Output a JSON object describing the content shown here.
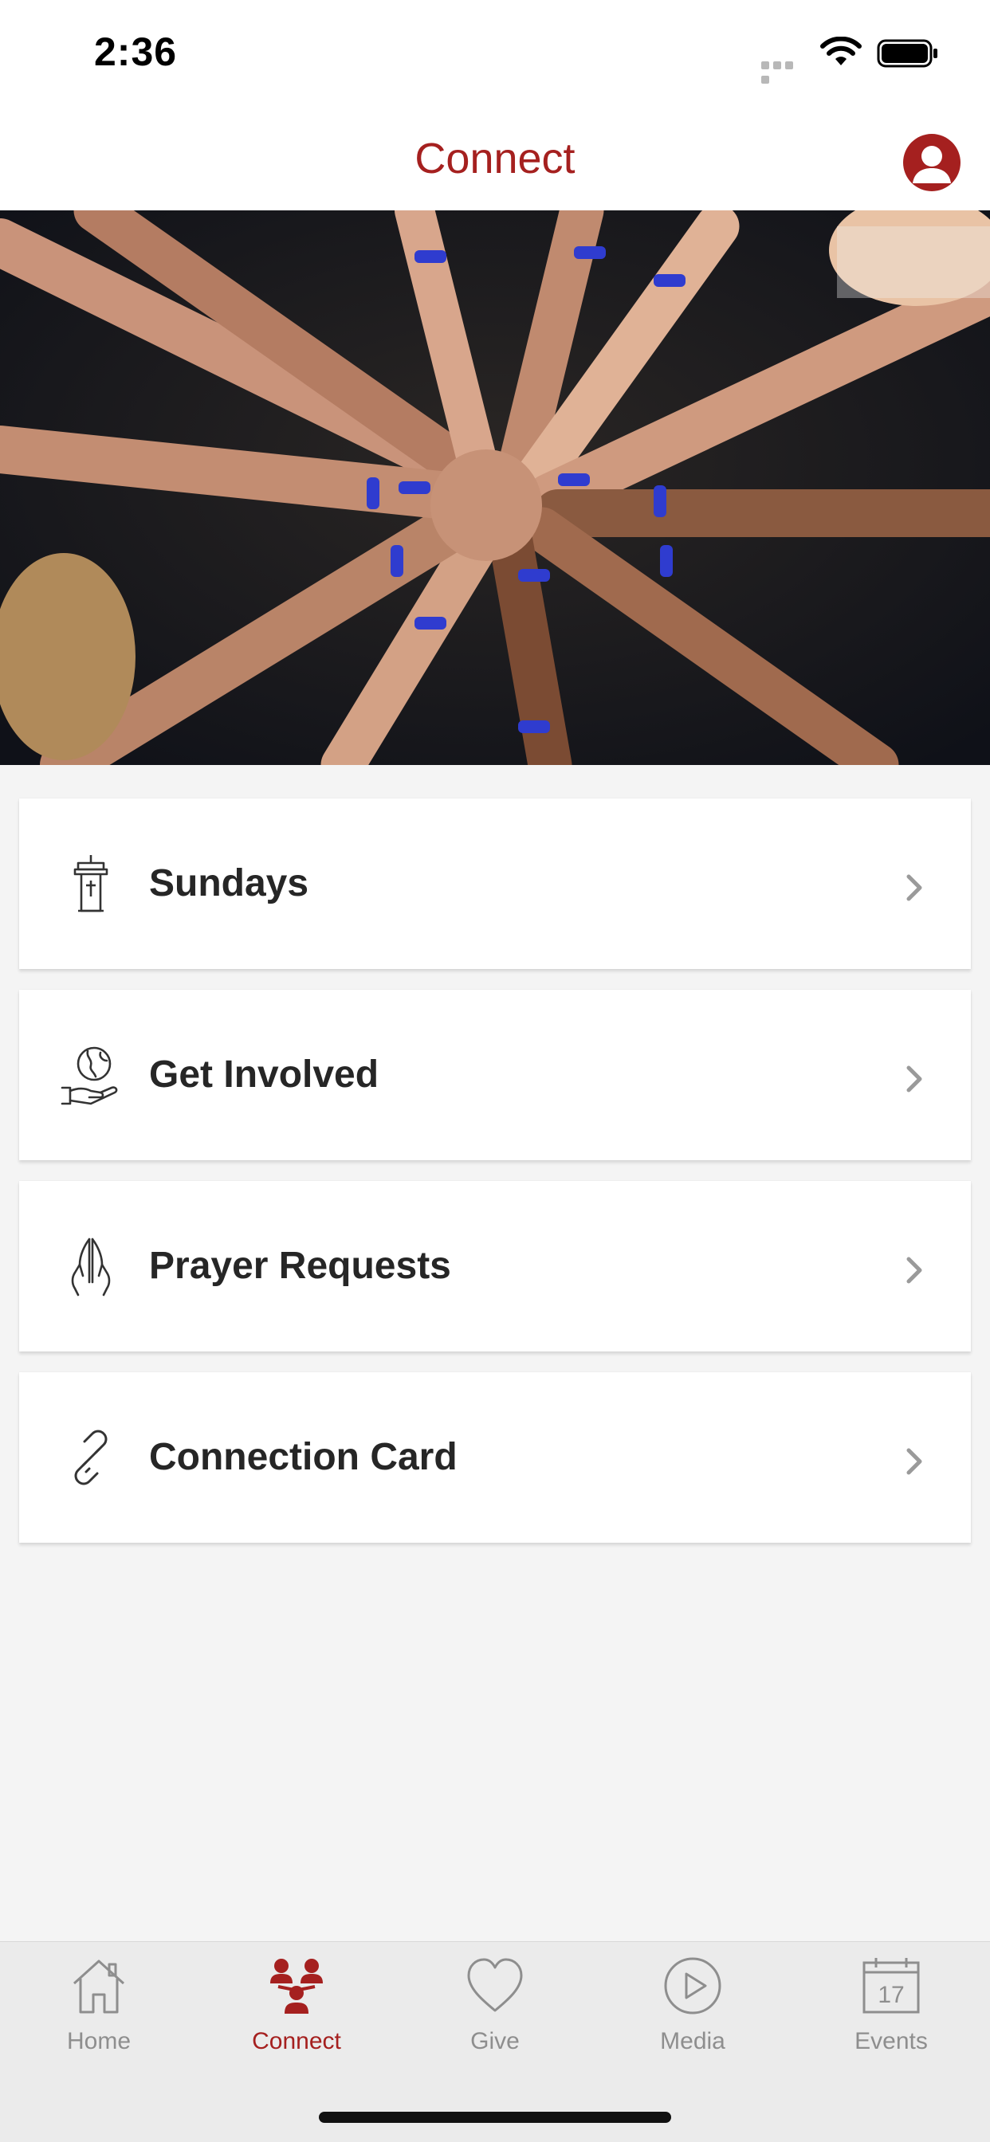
{
  "status_bar": {
    "time": "2:36"
  },
  "nav": {
    "title": "Connect"
  },
  "menu": [
    {
      "label": "Sundays",
      "icon": "pulpit-icon"
    },
    {
      "label": "Get Involved",
      "icon": "globe-in-hand-icon"
    },
    {
      "label": "Prayer Requests",
      "icon": "praying-hands-icon"
    },
    {
      "label": "Connection Card",
      "icon": "link-icon"
    }
  ],
  "tabs": [
    {
      "label": "Home",
      "icon": "home-icon",
      "active": false
    },
    {
      "label": "Connect",
      "icon": "people-group-icon",
      "active": true
    },
    {
      "label": "Give",
      "icon": "heart-icon",
      "active": false
    },
    {
      "label": "Media",
      "icon": "play-circle-icon",
      "active": false
    },
    {
      "label": "Events",
      "icon": "calendar-icon",
      "active": false,
      "calendar_day": "17"
    }
  ],
  "colors": {
    "accent": "#a5201f",
    "inactive": "#8e8e8e",
    "background": "#f4f4f4"
  }
}
